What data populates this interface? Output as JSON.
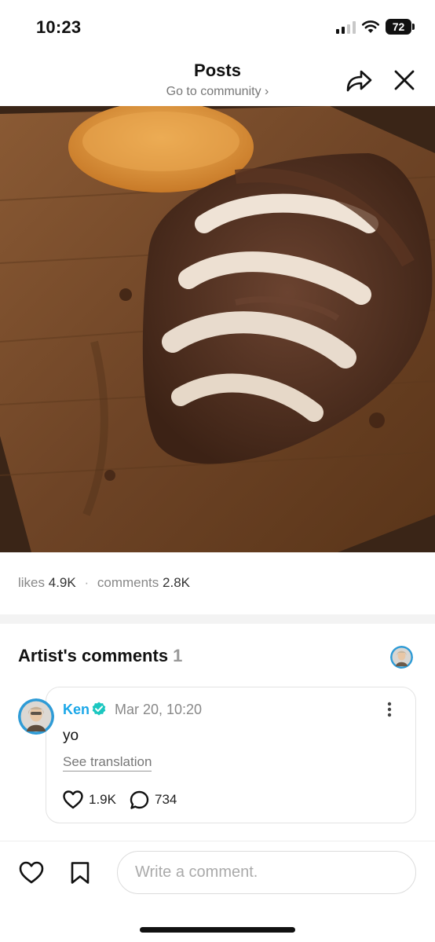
{
  "status_bar": {
    "time": "10:23",
    "battery": "72"
  },
  "header": {
    "title": "Posts",
    "subtitle": "Go to community ›"
  },
  "photo": {
    "description_icon": "cake-photo"
  },
  "stats": {
    "likes_label": "likes",
    "likes_count": "4.9K",
    "separator": "·",
    "comments_label": "comments",
    "comments_count": "2.8K"
  },
  "artist_comments": {
    "title": "Artist's comments",
    "count": "1",
    "comment": {
      "author": "Ken",
      "date": "Mar 20, 10:20",
      "text": "yo",
      "translation_link": "See translation",
      "likes": "1.9K",
      "replies": "734"
    }
  },
  "composer": {
    "placeholder": "Write a comment."
  },
  "colors": {
    "accent": "#1aa7e8",
    "verified": "#1cc7c0"
  }
}
